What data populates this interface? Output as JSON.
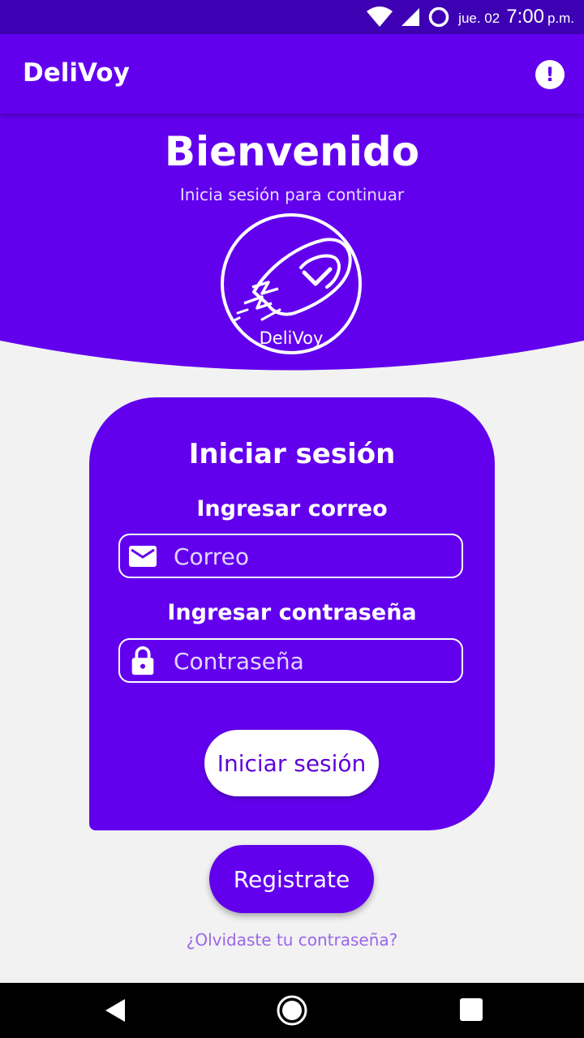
{
  "status_bar": {
    "date": "jue. 02",
    "time": "7:00",
    "ampm": "p.m.",
    "icons": [
      "wifi-icon",
      "signal-icon",
      "data-saver-icon"
    ]
  },
  "app_bar": {
    "title": "DeliVoy",
    "info_icon": "alert-circle-icon"
  },
  "header": {
    "title": "Bienvenido",
    "subtitle": "Inicia sesión para continuar",
    "logo_text": "DeliVoy"
  },
  "login": {
    "title": "Iniciar sesión",
    "email_label": "Ingresar correo",
    "email_placeholder": "Correo",
    "email_value": "",
    "email_icon": "email-icon",
    "password_label": "Ingresar contraseña",
    "password_placeholder": "Contraseña",
    "password_value": "",
    "password_icon": "lock-icon",
    "submit_label": "Iniciar sesión"
  },
  "register_label": "Registrate",
  "forgot_label": "¿Olvidaste tu contraseña?",
  "nav": {
    "back_icon": "back-icon",
    "home_icon": "home-icon",
    "recents_icon": "recents-icon"
  },
  "colors": {
    "primary": "#6200ee",
    "status_bar": "#3d00b3",
    "background": "#f2f2f2",
    "link": "#9a66e8"
  }
}
